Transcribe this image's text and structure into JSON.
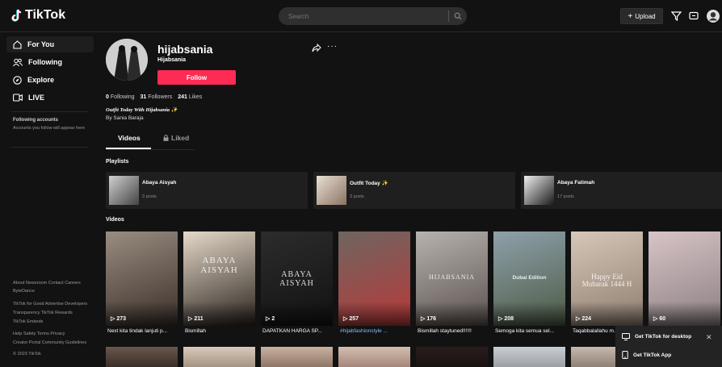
{
  "app": {
    "logo_text": "TikTok"
  },
  "header": {
    "search_placeholder": "Search",
    "upload_label": "Upload"
  },
  "sidebar": {
    "nav": [
      {
        "label": "For You",
        "icon": "home-icon"
      },
      {
        "label": "Following",
        "icon": "users-icon"
      },
      {
        "label": "Explore",
        "icon": "compass-icon"
      },
      {
        "label": "LIVE",
        "icon": "live-icon"
      }
    ],
    "following_title": "Following accounts",
    "following_note": "Accounts you follow will appear here",
    "footer_links": [
      "About Newsroom Contact Careers",
      "ByteDance",
      "TikTok for Good Advertise Developers",
      "Transparency TikTok Rewards",
      "TikTok Embeds",
      "Help Safety Terms Privacy",
      "Creator Portal Community Guidelines",
      "© 2023 TikTok"
    ]
  },
  "profile": {
    "username": "hijabsania",
    "nickname": "Hijabsania",
    "follow_label": "Follow",
    "following_count": "0",
    "following_label": "Following",
    "followers_count": "31",
    "followers_label": "Followers",
    "likes_count": "241",
    "likes_label": "Likes",
    "bio_line1": "Outfit Today With Hijabsania ✨",
    "bio_line2": "By Sania Baraja"
  },
  "tabs": [
    {
      "label": "Videos",
      "active": true
    },
    {
      "label": "Liked",
      "active": false
    }
  ],
  "playlists_title": "Playlists",
  "playlists": [
    {
      "title": "Abaya Aisyah",
      "posts": "3 posts"
    },
    {
      "title": "Outfit Today ✨",
      "posts": "3 posts"
    },
    {
      "title": "Abaya Fatimah",
      "posts": "17 posts"
    }
  ],
  "videos_title": "Videos",
  "videos": [
    {
      "views": "273",
      "caption": "Next kita tindak lanjuti p...",
      "overlay": "",
      "colors": [
        "#9a8c80",
        "#3a302a"
      ]
    },
    {
      "views": "211",
      "caption": "Bismillah",
      "overlay": "ABAYA AISYAH",
      "colors": [
        "#e6d9c8",
        "#2a2420"
      ]
    },
    {
      "views": "2",
      "caption": "DAPATKAN HARGA SP...",
      "overlay": "ABAYA AISYAH",
      "colors": [
        "#2c2c2c",
        "#121212"
      ]
    },
    {
      "views": "257",
      "caption": "#hijabfashionstyle ...",
      "overlay": "",
      "colors": [
        "#6e6560",
        "#b83a3a"
      ]
    },
    {
      "views": "176",
      "caption": "Bismillah staytuned!!!!!!",
      "overlay": "HIJABSANIA",
      "colors": [
        "#b8b2ae",
        "#5a524e"
      ]
    },
    {
      "views": "208",
      "caption": "Semoga kita semua sel...",
      "overlay": "Dubai Edition",
      "colors": [
        "#8ea1ab",
        "#4d5a45"
      ]
    },
    {
      "views": "224",
      "caption": "Taqabbalallahu m...",
      "overlay": "Happy Eid Mubarak 1444 H",
      "colors": [
        "#d6c7b8",
        "#8f7e70"
      ]
    },
    {
      "views": "60",
      "caption": "",
      "overlay": "",
      "colors": [
        "#d7c4c6",
        "#8c7f82"
      ]
    }
  ],
  "popup": {
    "desktop_label": "Get TikTok for desktop",
    "app_label": "Get TikTok App"
  },
  "colors": {
    "accent": "#fe2c55",
    "background": "#121212",
    "card": "#1f1f1f"
  }
}
